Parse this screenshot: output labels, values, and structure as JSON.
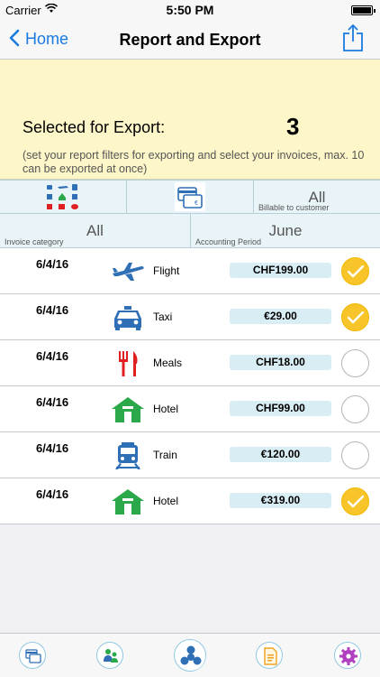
{
  "status_bar": {
    "carrier": "Carrier",
    "time": "5:50 PM"
  },
  "nav": {
    "back_label": "Home",
    "title": "Report and Export"
  },
  "export": {
    "label": "Selected for Export:",
    "count": "3",
    "hint": "(set your report filters for exporting and select your invoices, max. 10 can be exported at once)"
  },
  "filters": {
    "billable_value": "All",
    "billable_label": "Billable to customer",
    "category_value": "All",
    "category_label": "Invoice category",
    "period_value": "June",
    "period_label": "Accounting Period"
  },
  "invoices": [
    {
      "date": "6/4/16",
      "category": "Flight",
      "icon": "airplane-icon",
      "amount": "CHF199.00",
      "selected": true
    },
    {
      "date": "6/4/16",
      "category": "Taxi",
      "icon": "taxi-icon",
      "amount": "€29.00",
      "selected": true
    },
    {
      "date": "6/4/16",
      "category": "Meals",
      "icon": "fork-knife-icon",
      "amount": "CHF18.00",
      "selected": false
    },
    {
      "date": "6/4/16",
      "category": "Hotel",
      "icon": "hotel-icon",
      "amount": "CHF99.00",
      "selected": false
    },
    {
      "date": "6/4/16",
      "category": "Train",
      "icon": "train-icon",
      "amount": "€120.00",
      "selected": false
    },
    {
      "date": "6/4/16",
      "category": "Hotel",
      "icon": "hotel-icon",
      "amount": "€319.00",
      "selected": true
    }
  ],
  "tabs": [
    {
      "icon": "invoices-icon",
      "active": false
    },
    {
      "icon": "people-icon",
      "active": false
    },
    {
      "icon": "hub-icon",
      "active": true
    },
    {
      "icon": "document-icon",
      "active": false
    },
    {
      "icon": "settings-icon",
      "active": false
    }
  ],
  "colors": {
    "accent": "#1a7ae0",
    "export_panel_bg": "#fdf6c8",
    "filter_bg": "#e8f4f8",
    "amount_bg": "#d9eef4",
    "check_on": "#f7c52a",
    "icon_blue": "#2e6fb5",
    "icon_green": "#2aa84a",
    "icon_red": "#e02020"
  }
}
